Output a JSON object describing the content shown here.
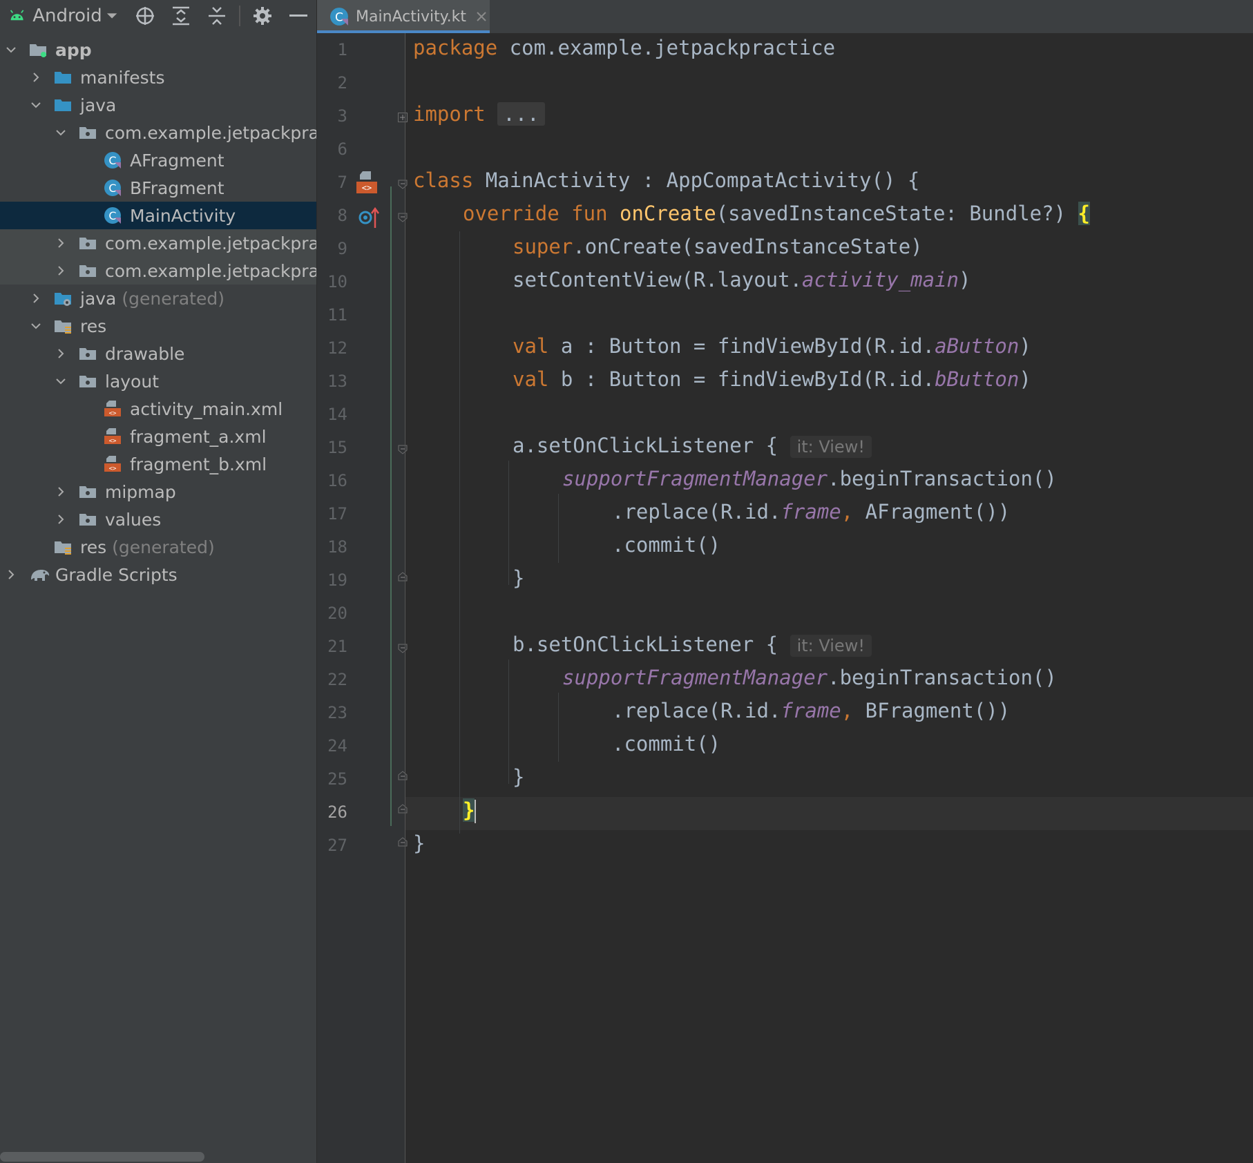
{
  "toolbar": {
    "view_label": "Android"
  },
  "tree": [
    {
      "label": "app",
      "bold": true
    },
    {
      "label": "manifests"
    },
    {
      "label": "java"
    },
    {
      "label": "com.example.jetpackpra"
    },
    {
      "label": "AFragment"
    },
    {
      "label": "BFragment"
    },
    {
      "label": "MainActivity"
    },
    {
      "label": "com.example.jetpackpra"
    },
    {
      "label": "com.example.jetpackpra"
    },
    {
      "label": "java",
      "suffix": "(generated)"
    },
    {
      "label": "res"
    },
    {
      "label": "drawable"
    },
    {
      "label": "layout"
    },
    {
      "label": "activity_main.xml"
    },
    {
      "label": "fragment_a.xml"
    },
    {
      "label": "fragment_b.xml"
    },
    {
      "label": "mipmap"
    },
    {
      "label": "values"
    },
    {
      "label": "res",
      "suffix": "(generated)"
    },
    {
      "label": "Gradle Scripts"
    }
  ],
  "editor": {
    "tab_label": "MainActivity.kt",
    "line_numbers": [
      "1",
      "2",
      "3",
      "6",
      "7",
      "8",
      "9",
      "10",
      "11",
      "12",
      "13",
      "14",
      "15",
      "16",
      "17",
      "18",
      "19",
      "20",
      "21",
      "22",
      "23",
      "24",
      "25",
      "26",
      "27"
    ],
    "code": {
      "l1_kw": "package",
      "l1_rest": " com.example.jetpackpractice",
      "l3_kw": "import",
      "l3_fold": "...",
      "l7_kw": "class",
      "l7_rest": " MainActivity : AppCompatActivity() {",
      "l8_kw1": "override",
      "l8_kw2": "fun",
      "l8_fn": "onCreate",
      "l8_rest": "(savedInstanceState: Bundle?) ",
      "l8_brace": "{",
      "l9_kw": "super",
      "l9_rest": ".onCreate(savedInstanceState)",
      "l10_a": "setContentView(R.layout.",
      "l10_it": "activity_main",
      "l10_b": ")",
      "l12_kw": "val",
      "l12_a": " a : Button = findViewById(R.id.",
      "l12_it": "aButton",
      "l12_b": ")",
      "l13_kw": "val",
      "l13_a": " b : Button = findViewById(R.id.",
      "l13_it": "bButton",
      "l13_b": ")",
      "l15_a": "a.setOnClickListener { ",
      "l15_hint": "it: View!",
      "l16_it": "supportFragmentManager",
      "l16_b": ".beginTransaction()",
      "l17_a": ".replace(R.id.",
      "l17_it": "frame",
      "l17_comma": ",",
      "l17_b": " AFragment())",
      "l18": ".commit()",
      "l19": "}",
      "l21_a": "b.setOnClickListener { ",
      "l21_hint": "it: View!",
      "l22_it": "supportFragmentManager",
      "l22_b": ".beginTransaction()",
      "l23_a": ".replace(R.id.",
      "l23_it": "frame",
      "l23_comma": ",",
      "l23_b": " BFragment())",
      "l24": ".commit()",
      "l25": "}",
      "l26": "}",
      "l27": "}"
    }
  }
}
